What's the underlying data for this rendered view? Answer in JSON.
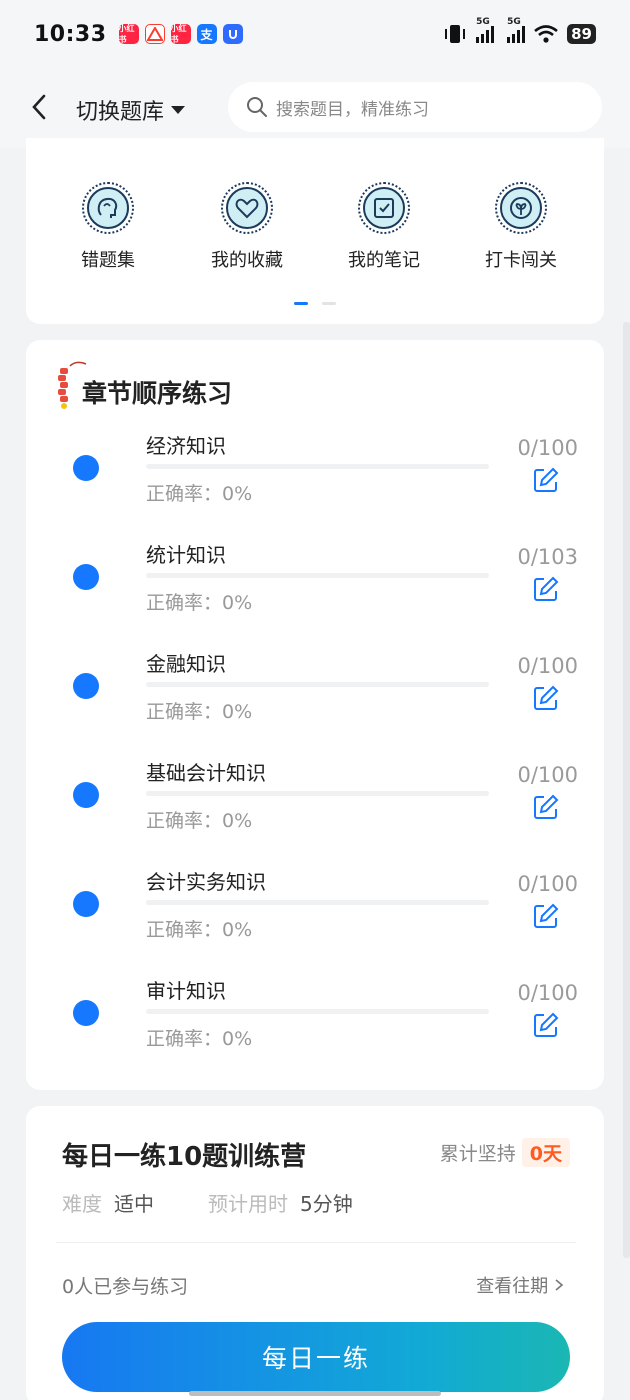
{
  "status_bar": {
    "time": "10:33",
    "battery": "89",
    "signal_label_1": "5G",
    "signal_label_2": "5G",
    "apps": [
      {
        "name": "xiaohongshu-icon",
        "color": "#ff2442",
        "text": "小红书"
      },
      {
        "name": "app-red-icon",
        "color": "#ff3b30",
        "text": ""
      },
      {
        "name": "xiaohongshu-icon-2",
        "color": "#ff2442",
        "text": "小红书"
      },
      {
        "name": "alipay-icon",
        "color": "#1677ff",
        "text": "支"
      },
      {
        "name": "app-blue-icon",
        "color": "#2f6bff",
        "text": ""
      }
    ]
  },
  "header": {
    "switch_label": "切换题库",
    "search_placeholder": "搜索题目，精准练习"
  },
  "tools": [
    {
      "label": "错题集",
      "icon": "head-icon"
    },
    {
      "label": "我的收藏",
      "icon": "heart-icon"
    },
    {
      "label": "我的笔记",
      "icon": "note-icon"
    },
    {
      "label": "打卡闯关",
      "icon": "plant-icon"
    }
  ],
  "chapter": {
    "title": "章节顺序练习",
    "items": [
      {
        "name": "经济知识",
        "accuracy": "正确率：0%",
        "count": "0/100",
        "progress": 0
      },
      {
        "name": "统计知识",
        "accuracy": "正确率：0%",
        "count": "0/103",
        "progress": 0
      },
      {
        "name": "金融知识",
        "accuracy": "正确率：0%",
        "count": "0/100",
        "progress": 0
      },
      {
        "name": "基础会计知识",
        "accuracy": "正确率：0%",
        "count": "0/100",
        "progress": 0
      },
      {
        "name": "会计实务知识",
        "accuracy": "正确率：0%",
        "count": "0/100",
        "progress": 0
      },
      {
        "name": "审计知识",
        "accuracy": "正确率：0%",
        "count": "0/100",
        "progress": 0
      }
    ]
  },
  "daily": {
    "title": "每日一练10题训练营",
    "persist_label": "累计坚持",
    "persist_value": "0天",
    "difficulty_label": "难度",
    "difficulty_value": "适中",
    "time_label": "预计用时",
    "time_value": "5分钟",
    "joined": "0人已参与练习",
    "history": "查看往期",
    "cta": "每日一练"
  },
  "colors": {
    "accent": "#1677ff",
    "badge_text": "#ff5a1f",
    "cta_start": "#1778f2",
    "cta_end": "#1ab7b3"
  }
}
